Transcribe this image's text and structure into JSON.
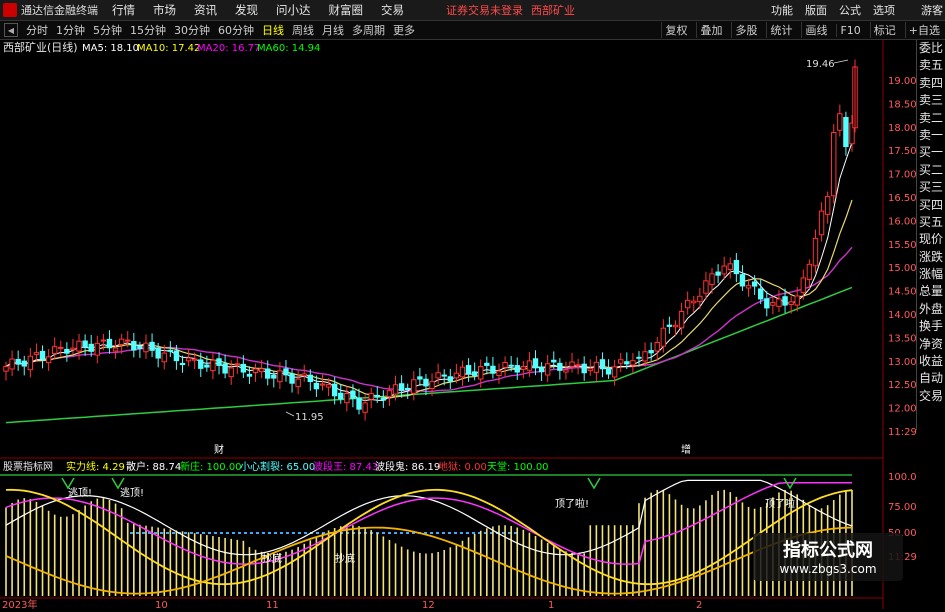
{
  "menubar": {
    "app_title": "通达信金融终端",
    "items": [
      "行情",
      "市场",
      "资讯",
      "发现",
      "问小达",
      "财富圈",
      "交易"
    ],
    "notice": "证券交易未登录",
    "stock_name": "西部矿业",
    "right_items": [
      "功能",
      "版面",
      "公式",
      "选项"
    ],
    "guest": "游客"
  },
  "toolbar": {
    "periods": [
      "分时",
      "1分钟",
      "5分钟",
      "15分钟",
      "30分钟",
      "60分钟",
      "日线",
      "周线",
      "月线",
      "多周期",
      "更多"
    ],
    "active_period": "日线",
    "right_buttons": [
      "复权",
      "叠加",
      "多股",
      "统计",
      "画线",
      "F10",
      "标记",
      "+自选"
    ]
  },
  "main_chart": {
    "title": "西部矿业(日线)",
    "ma5_label": "MA5: 18.10",
    "ma10_label": "MA10: 17.42",
    "ma20_label": "MA20: 16.77",
    "ma60_label": "MA60: 14.94",
    "high_marker": "19.46",
    "low_marker": "11.95",
    "event_cai": "财",
    "event_zeng": "增",
    "price_ticks": [
      "19.00",
      "18.50",
      "18.00",
      "17.50",
      "17.00",
      "16.50",
      "16.00",
      "15.50",
      "15.00",
      "14.50",
      "14.00",
      "13.50",
      "13.00",
      "12.50",
      "12.00",
      "11:29"
    ],
    "colors": {
      "ma5": "#ffffff",
      "ma10": "#ffff00",
      "ma20": "#ff00ff",
      "ma60": "#00ff00",
      "up": "#ff3232",
      "down": "#54ffff"
    }
  },
  "side_panel": {
    "items": [
      "委比",
      "卖五",
      "卖四",
      "卖三",
      "卖二",
      "卖一",
      "买一",
      "买二",
      "买三",
      "买四",
      "买五",
      "现价",
      "涨跌",
      "涨幅",
      "总量",
      "外盘",
      "换手",
      "净资",
      "收益",
      "自动",
      "交易"
    ]
  },
  "indicator": {
    "name": "股票指标网",
    "strength_label": "实力线: 4.29",
    "retail_label": "散户: 88.74",
    "new_label": "新庄: 100.00",
    "caution_label": "小心割裂: 65.00",
    "band_king_label": "波段王: 87.43",
    "band_ghost_label": "波段鬼: 86.19",
    "floor_label": "地狱: 0.00",
    "heaven_label": "天堂: 100.00",
    "ticks": [
      "100.0",
      "75.00",
      "50.00",
      "11:29"
    ],
    "signal_labels": [
      "逃顶!",
      "逃顶!",
      "抄底",
      "抄底",
      "顶了啦!",
      "顶了啦!"
    ]
  },
  "x_axis": {
    "labels": [
      "2023年",
      "10",
      "11",
      "12",
      "1",
      "2"
    ]
  },
  "watermark": {
    "title": "指标公式网",
    "url": "www.zbgs3.com"
  }
}
